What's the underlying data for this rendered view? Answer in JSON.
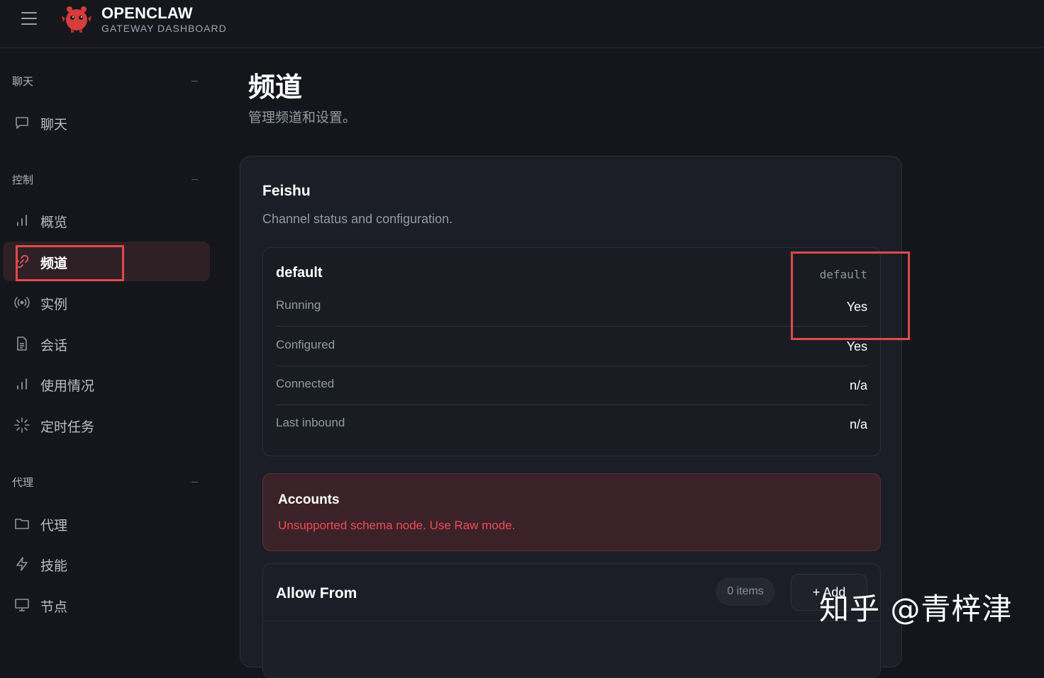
{
  "header": {
    "title": "OPENCLAW",
    "subtitle": "GATEWAY DASHBOARD",
    "menu_icon": "hamburger-icon",
    "logo_icon": "lobster-logo"
  },
  "sidebar": {
    "sections": [
      {
        "label": "聊天",
        "items": [
          {
            "label": "聊天",
            "icon": "chat-bubble-icon"
          }
        ]
      },
      {
        "label": "控制",
        "items": [
          {
            "label": "概览",
            "icon": "bar-chart-icon"
          },
          {
            "label": "频道",
            "icon": "link-icon",
            "active": true
          },
          {
            "label": "实例",
            "icon": "broadcast-icon"
          },
          {
            "label": "会话",
            "icon": "document-icon"
          },
          {
            "label": "使用情况",
            "icon": "bar-chart-icon"
          },
          {
            "label": "定时任务",
            "icon": "spinner-icon"
          }
        ]
      },
      {
        "label": "代理",
        "items": [
          {
            "label": "代理",
            "icon": "folder-icon"
          },
          {
            "label": "技能",
            "icon": "lightning-icon"
          },
          {
            "label": "节点",
            "icon": "monitor-icon"
          }
        ]
      }
    ]
  },
  "main": {
    "title": "频道",
    "subtitle": "管理频道和设置。",
    "channel": {
      "title": "Feishu",
      "subtitle": "Channel status and configuration.",
      "account": {
        "name": "default",
        "id": "default",
        "rows": [
          {
            "key": "Running",
            "value": "Yes"
          },
          {
            "key": "Configured",
            "value": "Yes"
          },
          {
            "key": "Connected",
            "value": "n/a"
          },
          {
            "key": "Last inbound",
            "value": "n/a"
          }
        ]
      },
      "accounts_panel": {
        "title": "Accounts",
        "error": "Unsupported schema node. Use Raw mode."
      },
      "allow_from": {
        "title": "Allow From",
        "count": "0 items",
        "add_label": "+ Add"
      }
    }
  },
  "watermark": "知乎 @青梓津",
  "colors": {
    "background": "#14161c",
    "card": "#1b1e26",
    "accent_red": "#ef4b55",
    "active_nav": "#2f2026"
  }
}
